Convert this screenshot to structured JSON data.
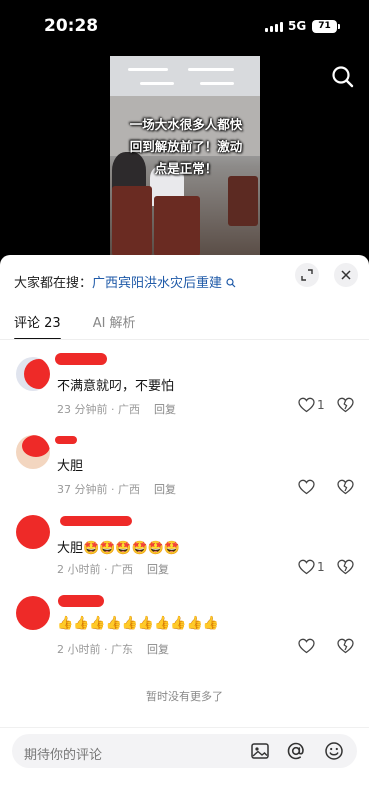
{
  "status_bar": {
    "time": "20:28",
    "network": "5G",
    "battery": "71"
  },
  "video": {
    "caption": "一场大水很多人都快回到解放前了！激动点是正常！"
  },
  "sheet": {
    "everyone_prefix": "大家都在搜：",
    "everyone_link": "广西宾阳洪水灾后重建",
    "tabs": [
      {
        "label": "评论 23"
      },
      {
        "label": "AI 解析"
      }
    ]
  },
  "comments": [
    {
      "text": "不满意就叼，不要怕",
      "time": "23 分钟前 · 广西",
      "reply": "回复",
      "likes": "1"
    },
    {
      "text": "大胆",
      "time": "37 分钟前 · 广西",
      "reply": "回复",
      "likes": ""
    },
    {
      "text": "大胆🤩🤩🤩🤩🤩🤩",
      "time": "2 小时前 · 广西",
      "reply": "回复",
      "likes": "1"
    },
    {
      "text": "👍👍👍👍👍👍👍👍👍👍",
      "time": "2 小时前 · 广东",
      "reply": "回复",
      "likes": ""
    }
  ],
  "footer": {
    "no_more": "暂时没有更多了",
    "input_placeholder": "期待你的评论"
  },
  "colors": {
    "link": "#1f5aa8",
    "redaction": "#ee2a28"
  }
}
